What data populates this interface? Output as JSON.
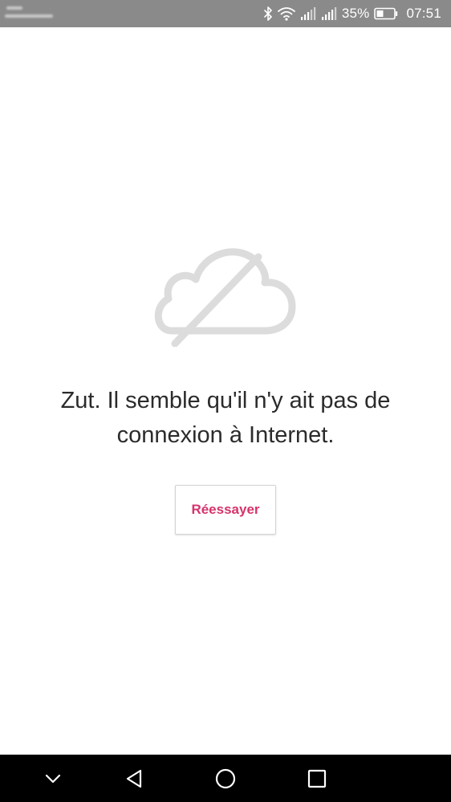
{
  "status_bar": {
    "battery_percent": "35%",
    "time": "07:51",
    "icons": [
      "bluetooth-icon",
      "wifi-icon",
      "signal-icon",
      "signal-icon",
      "battery-icon"
    ]
  },
  "main": {
    "icon": "cloud-offline-icon",
    "message": "Zut. Il semble qu'il n'y ait pas de connexion à Internet.",
    "retry_label": "Réessayer"
  },
  "navigation_bar": {
    "icons": [
      "chevron-down-icon",
      "back-triangle-icon",
      "home-circle-icon",
      "recents-square-icon"
    ]
  },
  "colors": {
    "status_bar_bg": "#8a8a8a",
    "accent": "#d6336c",
    "icon_gray": "#dcdcdc",
    "nav_bar_bg": "#000000"
  }
}
